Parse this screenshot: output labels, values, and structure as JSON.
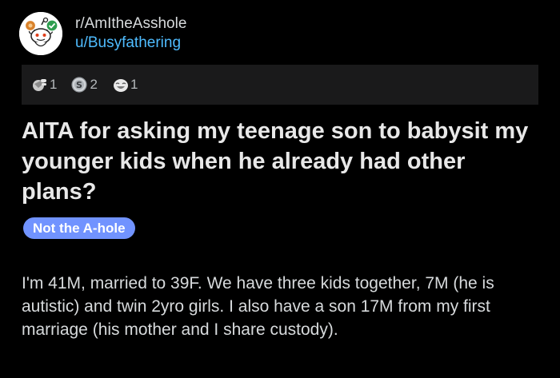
{
  "post": {
    "subreddit": "r/AmItheAsshole",
    "username": "u/Busyfathering",
    "title": "AITA for asking my teenage son to babysit my younger kids when he already had other plans?",
    "flair": "Not the A-hole",
    "body": "I'm 41M, married to 39F. We have three kids together, 7M (he is autistic) and twin 2yro girls. I also have a son 17M from my first marriage (his mother and I share custody)."
  },
  "awards": [
    {
      "icon": "facepalm-award-icon",
      "count": "1"
    },
    {
      "icon": "silver-award-icon",
      "count": "2"
    },
    {
      "icon": "laughing-award-icon",
      "count": "1"
    }
  ],
  "colors": {
    "background": "#000000",
    "text": "#d7dadc",
    "username": "#4fbcff",
    "flair_bg": "#7193ff",
    "awards_bar_bg": "#1a1a1b"
  }
}
